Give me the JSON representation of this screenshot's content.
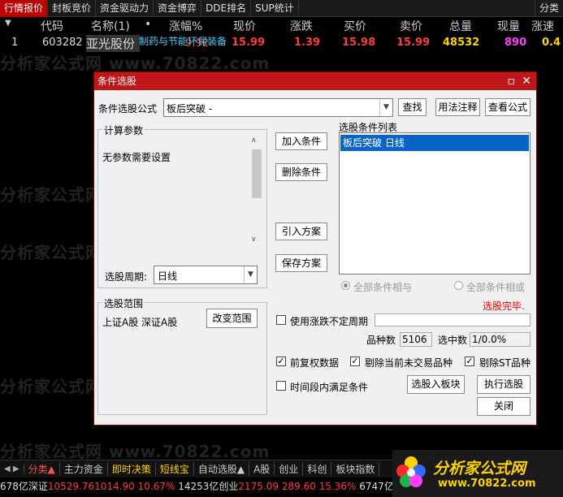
{
  "top_tabs": [
    "行情报价",
    "封板竞价",
    "资金驱动力",
    "资金博弈",
    "DDE排名",
    "SUP统计"
  ],
  "top_right": "分类",
  "columns": [
    "代码",
    "名称(1)",
    "•",
    "涨幅%",
    "现价",
    "涨跌",
    "买价",
    "卖价",
    "总量",
    "现量",
    "涨速"
  ],
  "row": {
    "index": "1",
    "code": "603282",
    "name": "亚光股份",
    "tag": "制药与节能环保装备",
    "change_pct": "9.92",
    "price": "15.99",
    "change": "1.39",
    "bid": "15.98",
    "ask": "15.99",
    "volume": "48532",
    "cur_volume": "890",
    "speed": "0.4"
  },
  "watermark": "分析家公式网 www.70822.com",
  "dialog": {
    "title": "条件选股",
    "formula_label": "条件选股公式",
    "formula_value": "板后突破  -",
    "find": "查找",
    "usage": "用法注释",
    "view_formula": "查看公式",
    "params_group": "计算参数",
    "no_params": "无参数需要设置",
    "period_label": "选股周期:",
    "period_value": "日线",
    "add_condition": "加入条件",
    "delete_condition": "删除条件",
    "import_plan": "引入方案",
    "save_plan": "保存方案",
    "list_label": "选股条件列表",
    "list_items": [
      "板后突破  日线"
    ],
    "and_label": "全部条件相与",
    "or_label": "全部条件相或",
    "done_text": "选股完毕.",
    "range_group": "选股范围",
    "range_value": "上证A股 深证A股",
    "change_range": "改变范围",
    "variable_period": "使用涨跌不定周期",
    "count_label": "品种数",
    "count_value": "5106",
    "hit_label": "选中数",
    "hit_value": "1/0.0%",
    "pre_adjust": "前复权数据",
    "exclude_non_trading": "剔除当前未交易品种",
    "exclude_st": "剔除ST品种",
    "in_period": "时间段内满足条件",
    "to_board": "选股入板块",
    "execute": "执行选股",
    "close": "关闭"
  },
  "bottom_tabs": [
    "分类▲",
    "主力资金",
    "即时决策",
    "短线宝",
    "自动选股▲",
    "A股",
    "创业",
    "科创",
    "板块指数"
  ],
  "status": {
    "s1": "678亿深证",
    "s2": "10529.76",
    "s3": "1014.90",
    "s4": "10.67%",
    "s5": "14253亿创业",
    "s6": "2175.09",
    "s7": "289.60",
    "s8": "15.36%",
    "s9": "6747亿"
  },
  "logo": {
    "line1": "分析家公式网",
    "line2": "www.70822.com"
  },
  "colors": {
    "accent_red": "#c0161a",
    "up_red": "#ff3c3c",
    "yellow": "#ffd200",
    "magenta": "#ff40ff",
    "cyan": "#4dd2ff"
  }
}
